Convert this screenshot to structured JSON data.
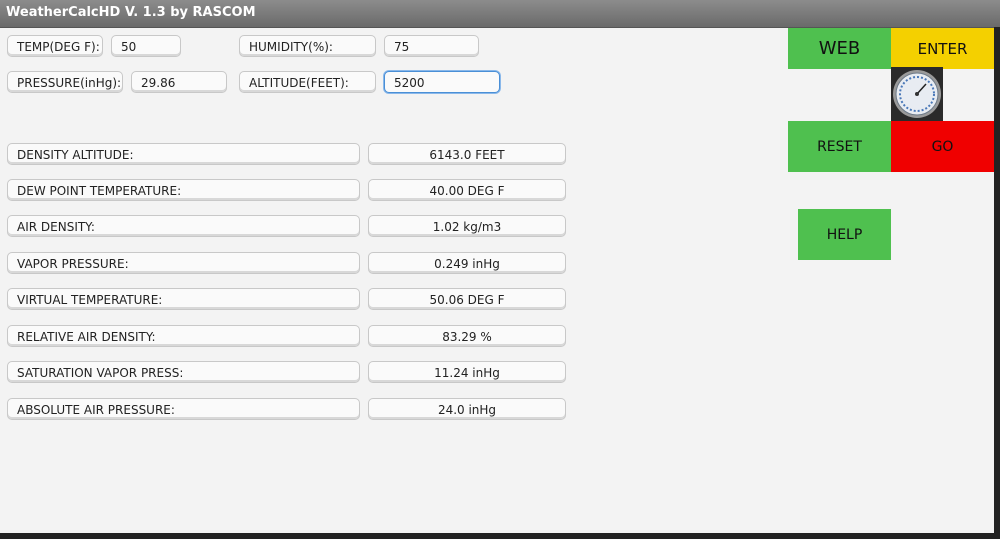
{
  "window": {
    "title": "WeatherCalcHD V. 1.3 by RASCOM"
  },
  "inputs": {
    "temp_label": "TEMP(DEG F):",
    "temp_value": "50",
    "humidity_label": "HUMIDITY(%):",
    "humidity_value": "75",
    "pressure_label": "PRESSURE(inHg):",
    "pressure_value": "29.86",
    "altitude_label": "ALTITUDE(FEET):",
    "altitude_value": "5200"
  },
  "results": [
    {
      "label": "DENSITY ALTITUDE:",
      "value": "6143.0 FEET"
    },
    {
      "label": "DEW POINT TEMPERATURE:",
      "value": "40.00 DEG F"
    },
    {
      "label": "AIR DENSITY:",
      "value": "1.02  kg/m3"
    },
    {
      "label": "VAPOR PRESSURE:",
      "value": "0.249 inHg"
    },
    {
      "label": "VIRTUAL TEMPERATURE:",
      "value": "50.06 DEG F"
    },
    {
      "label": "RELATIVE AIR DENSITY:",
      "value": "83.29 %"
    },
    {
      "label": "SATURATION VAPOR PRESS:",
      "value": "11.24 inHg"
    },
    {
      "label": "ABSOLUTE AIR PRESSURE:",
      "value": "24.0 inHg"
    }
  ],
  "buttons": {
    "web": "WEB",
    "enter": "ENTER",
    "reset": "RESET",
    "go": "GO",
    "help": "HELP"
  },
  "icons": {
    "gauge": "barometer-gauge-icon"
  },
  "colors": {
    "green": "#4fc04f",
    "yellow": "#f4d000",
    "red": "#f00000",
    "focus": "#4a8fd6"
  }
}
